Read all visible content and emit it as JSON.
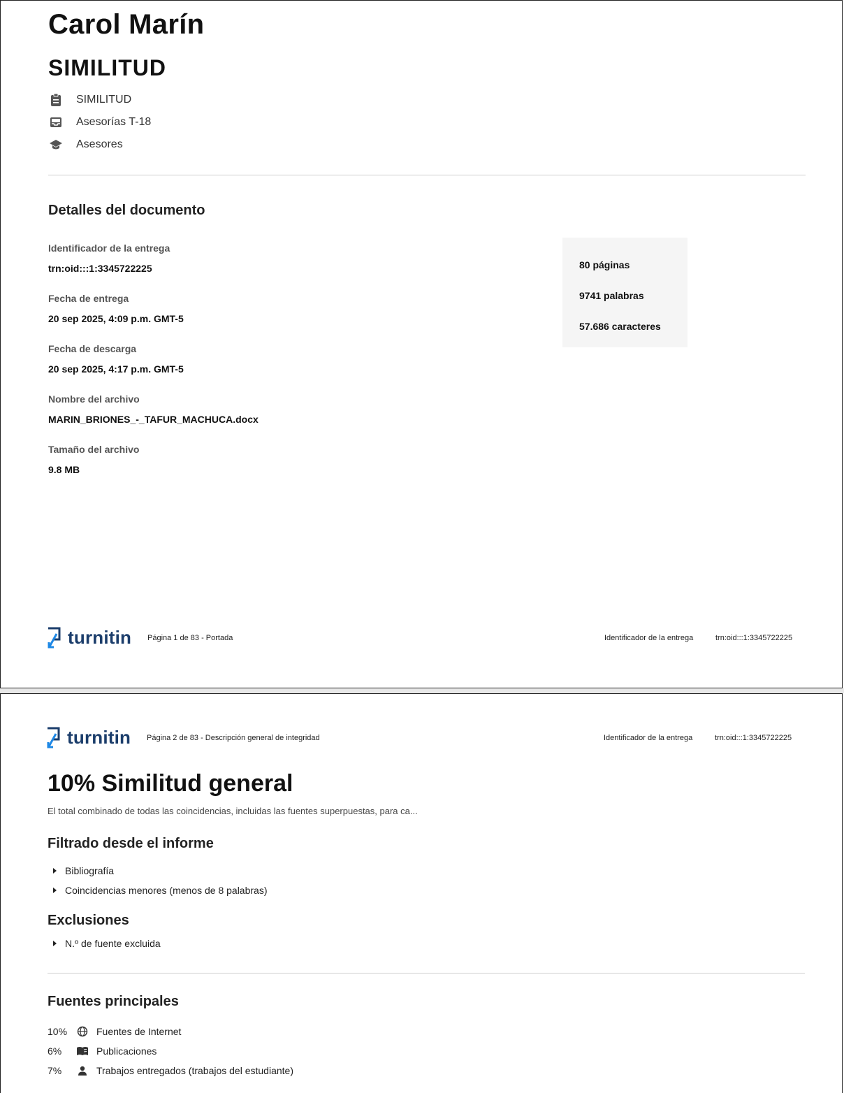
{
  "page1": {
    "author": "Carol Marín",
    "assignment_title": "SIMILITUD",
    "meta": [
      {
        "icon": "clipboard-icon",
        "text": "SIMILITUD"
      },
      {
        "icon": "inbox-icon",
        "text": "Asesorías T-18"
      },
      {
        "icon": "graduation-cap-icon",
        "text": "Asesores"
      }
    ],
    "details_heading": "Detalles del documento",
    "details": [
      {
        "label": "Identificador de la entrega",
        "value": "trn:oid:::1:3345722225"
      },
      {
        "label": "Fecha de entrega",
        "value": "20 sep 2025, 4:09 p.m. GMT-5"
      },
      {
        "label": "Fecha de descarga",
        "value": "20 sep 2025, 4:17 p.m. GMT-5"
      },
      {
        "label": "Nombre del archivo",
        "value": "MARIN_BRIONES_-_TAFUR_MACHUCA.docx"
      },
      {
        "label": "Tamaño del archivo",
        "value": "9.8 MB"
      }
    ],
    "stats": [
      "80 páginas",
      "9741 palabras",
      "57.686 caracteres"
    ],
    "footer": {
      "logo": "turnitin",
      "page_label": "Página 1 de 83 - Portada",
      "id_label": "Identificador de la entrega",
      "id_value": "trn:oid:::1:3345722225"
    }
  },
  "page2": {
    "header": {
      "logo": "turnitin",
      "page_label": "Página 2 de 83 - Descripción general de integridad",
      "id_label": "Identificador de la entrega",
      "id_value": "trn:oid:::1:3345722225"
    },
    "similarity_title": "10% Similitud general",
    "similarity_subtitle": "El total combinado de todas las coincidencias, incluidas las fuentes superpuestas, para ca...",
    "filtered_heading": "Filtrado desde el informe",
    "filtered_items": [
      "Bibliografía",
      "Coincidencias menores (menos de 8 palabras)"
    ],
    "exclusions_heading": "Exclusiones",
    "exclusion_items": [
      "N.º de fuente excluida"
    ],
    "sources_heading": "Fuentes principales",
    "sources": [
      {
        "pct": "10%",
        "icon": "globe-icon",
        "label": "Fuentes de Internet"
      },
      {
        "pct": "6%",
        "icon": "book-icon",
        "label": "Publicaciones"
      },
      {
        "pct": "7%",
        "icon": "person-icon",
        "label": "Trabajos entregados (trabajos del estudiante)"
      }
    ]
  },
  "colors": {
    "brand": "#1b3d6b",
    "accent": "#1e88e5",
    "stats_bg": "#f5f5f5"
  }
}
